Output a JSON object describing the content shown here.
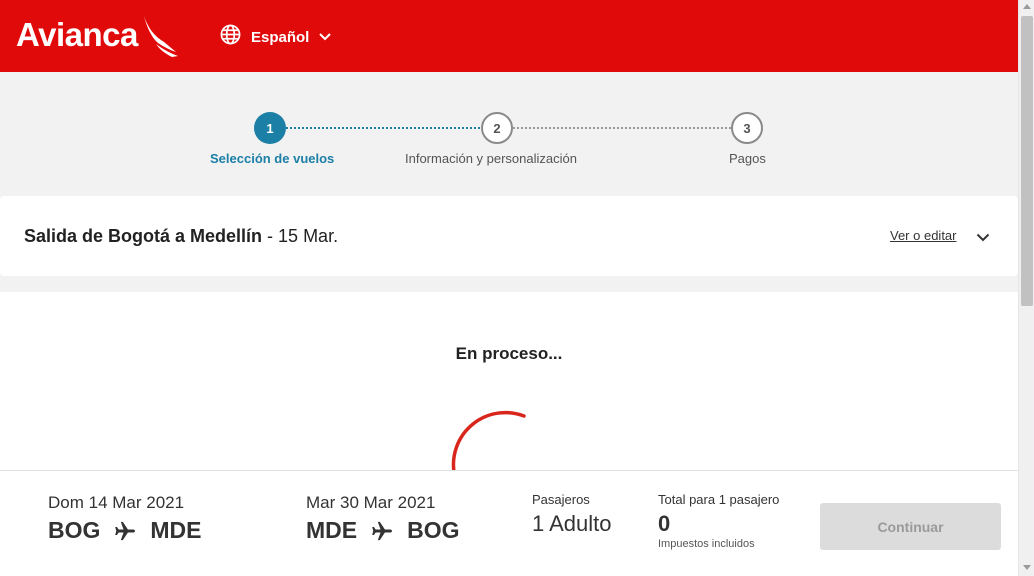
{
  "header": {
    "brand": "Avianca",
    "language_label": "Español",
    "icons": {
      "language": "globe-icon",
      "language_toggle": "chevron-down-icon",
      "brand": "bird-logo-icon"
    }
  },
  "stepper": {
    "steps": [
      {
        "number": "1",
        "label": "Selección de vuelos",
        "active": true
      },
      {
        "number": "2",
        "label": "Información y personalización",
        "active": false
      },
      {
        "number": "3",
        "label": "Pagos",
        "active": false
      }
    ]
  },
  "flight": {
    "title_bold": "Salida de Bogotá a Medellín",
    "title_date": " - 15 Mar.",
    "edit_label": "Ver o editar",
    "icons": {
      "edit_toggle": "chevron-down-icon"
    }
  },
  "processing": {
    "text": "En proceso...",
    "icons": {
      "loader": "loading-spinner-icon"
    }
  },
  "footer": {
    "outbound": {
      "date": "Dom 14 Mar 2021",
      "from": "BOG",
      "to": "MDE"
    },
    "return": {
      "date": "Mar 30 Mar 2021",
      "from": "MDE",
      "to": "BOG"
    },
    "passengers_label": "Pasajeros",
    "passengers_value": "1 Adulto",
    "total_label": "Total para 1 pasajero",
    "total_value": "0",
    "taxes_note": "Impuestos incluidos",
    "continue_label": "Continuar",
    "icons": {
      "route": "airplane-icon"
    }
  },
  "colors": {
    "brand_red": "#e10a0a",
    "accent_blue": "#1b7fa6",
    "spinner_red": "#d9261c",
    "disabled_button": "#dcdcdc"
  }
}
